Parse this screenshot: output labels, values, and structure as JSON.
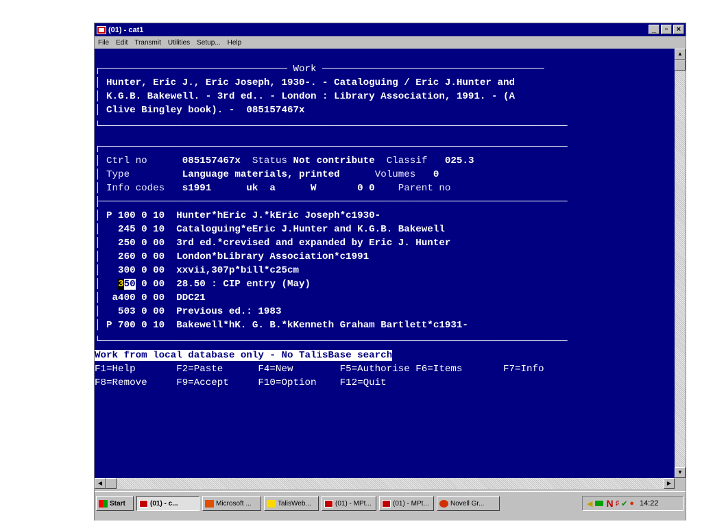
{
  "window": {
    "title": "(01) - cat1",
    "min": "_",
    "max": "▫",
    "close": "×"
  },
  "menu": [
    "File",
    "Edit",
    "Transmit",
    "Utilities",
    "Setup...",
    "Help"
  ],
  "work": {
    "header": "Work",
    "lines": [
      "Hunter, Eric J., Eric Joseph, 1930-. - Cataloguing / Eric J.Hunter and",
      "K.G.B. Bakewell. - 3rd ed.. - London : Library Association, 1991. - (A",
      "Clive Bingley book). -  085157467x"
    ]
  },
  "record": {
    "ctrl_label": "Ctrl no",
    "ctrl_value": "085157467x",
    "status_label": "Status",
    "status_value": "Not contribute",
    "classif_label": "Classif",
    "classif_value": "025.3",
    "type_label": "Type",
    "type_value": "Language materials, printed",
    "volumes_label": "Volumes",
    "volumes_value": "0",
    "info_label": "Info codes",
    "info_value": "s1991      uk  a      W       0 0",
    "parent_label": "Parent no"
  },
  "marc": [
    {
      "tag": "P 100 0 10",
      "text": "Hunter*hEric J.*kEric Joseph*c1930-"
    },
    {
      "tag": "  245 0 10",
      "text": "Cataloguing*eEric J.Hunter and K.G.B. Bakewell"
    },
    {
      "tag": "  250 0 00",
      "text": "3rd ed.*crevised and expanded by Eric J. Hunter"
    },
    {
      "tag": "  260 0 00",
      "text": "London*bLibrary Association*c1991"
    },
    {
      "tag": "  300 0 00",
      "text": "xxvii,307p*bill*c25cm"
    },
    {
      "tag_a": "3",
      "tag_b": "50",
      "tag_rest": " 0 00",
      "text": "28.50 : CIP entry (May)"
    },
    {
      "tag": " a400 0 00",
      "text": "DDC21"
    },
    {
      "tag": "  503 0 00",
      "text": "Previous ed.: 1983"
    },
    {
      "tag": "P 700 0 10",
      "text": "Bakewell*hK. G. B.*kKenneth Graham Bartlett*c1931-"
    }
  ],
  "status_message": "Work from local database only - No TalisBase search",
  "fkeys_row1": "F1=Help       F2=Paste      F4=New        F5=Authorise F6=Items       F7=Info",
  "fkeys_row2": "F8=Remove     F9=Accept     F10=Option    F12=Quit",
  "taskbar": {
    "start": "Start",
    "buttons": [
      "(01) - c...",
      "Microsoft ...",
      "TalisWeb...",
      "(01) - MPt...",
      "(01) - MPt...",
      "Novell Gr..."
    ],
    "time": "14:22"
  },
  "colors": {
    "terminal_bg": "#000080",
    "titlebar": "#000080"
  }
}
